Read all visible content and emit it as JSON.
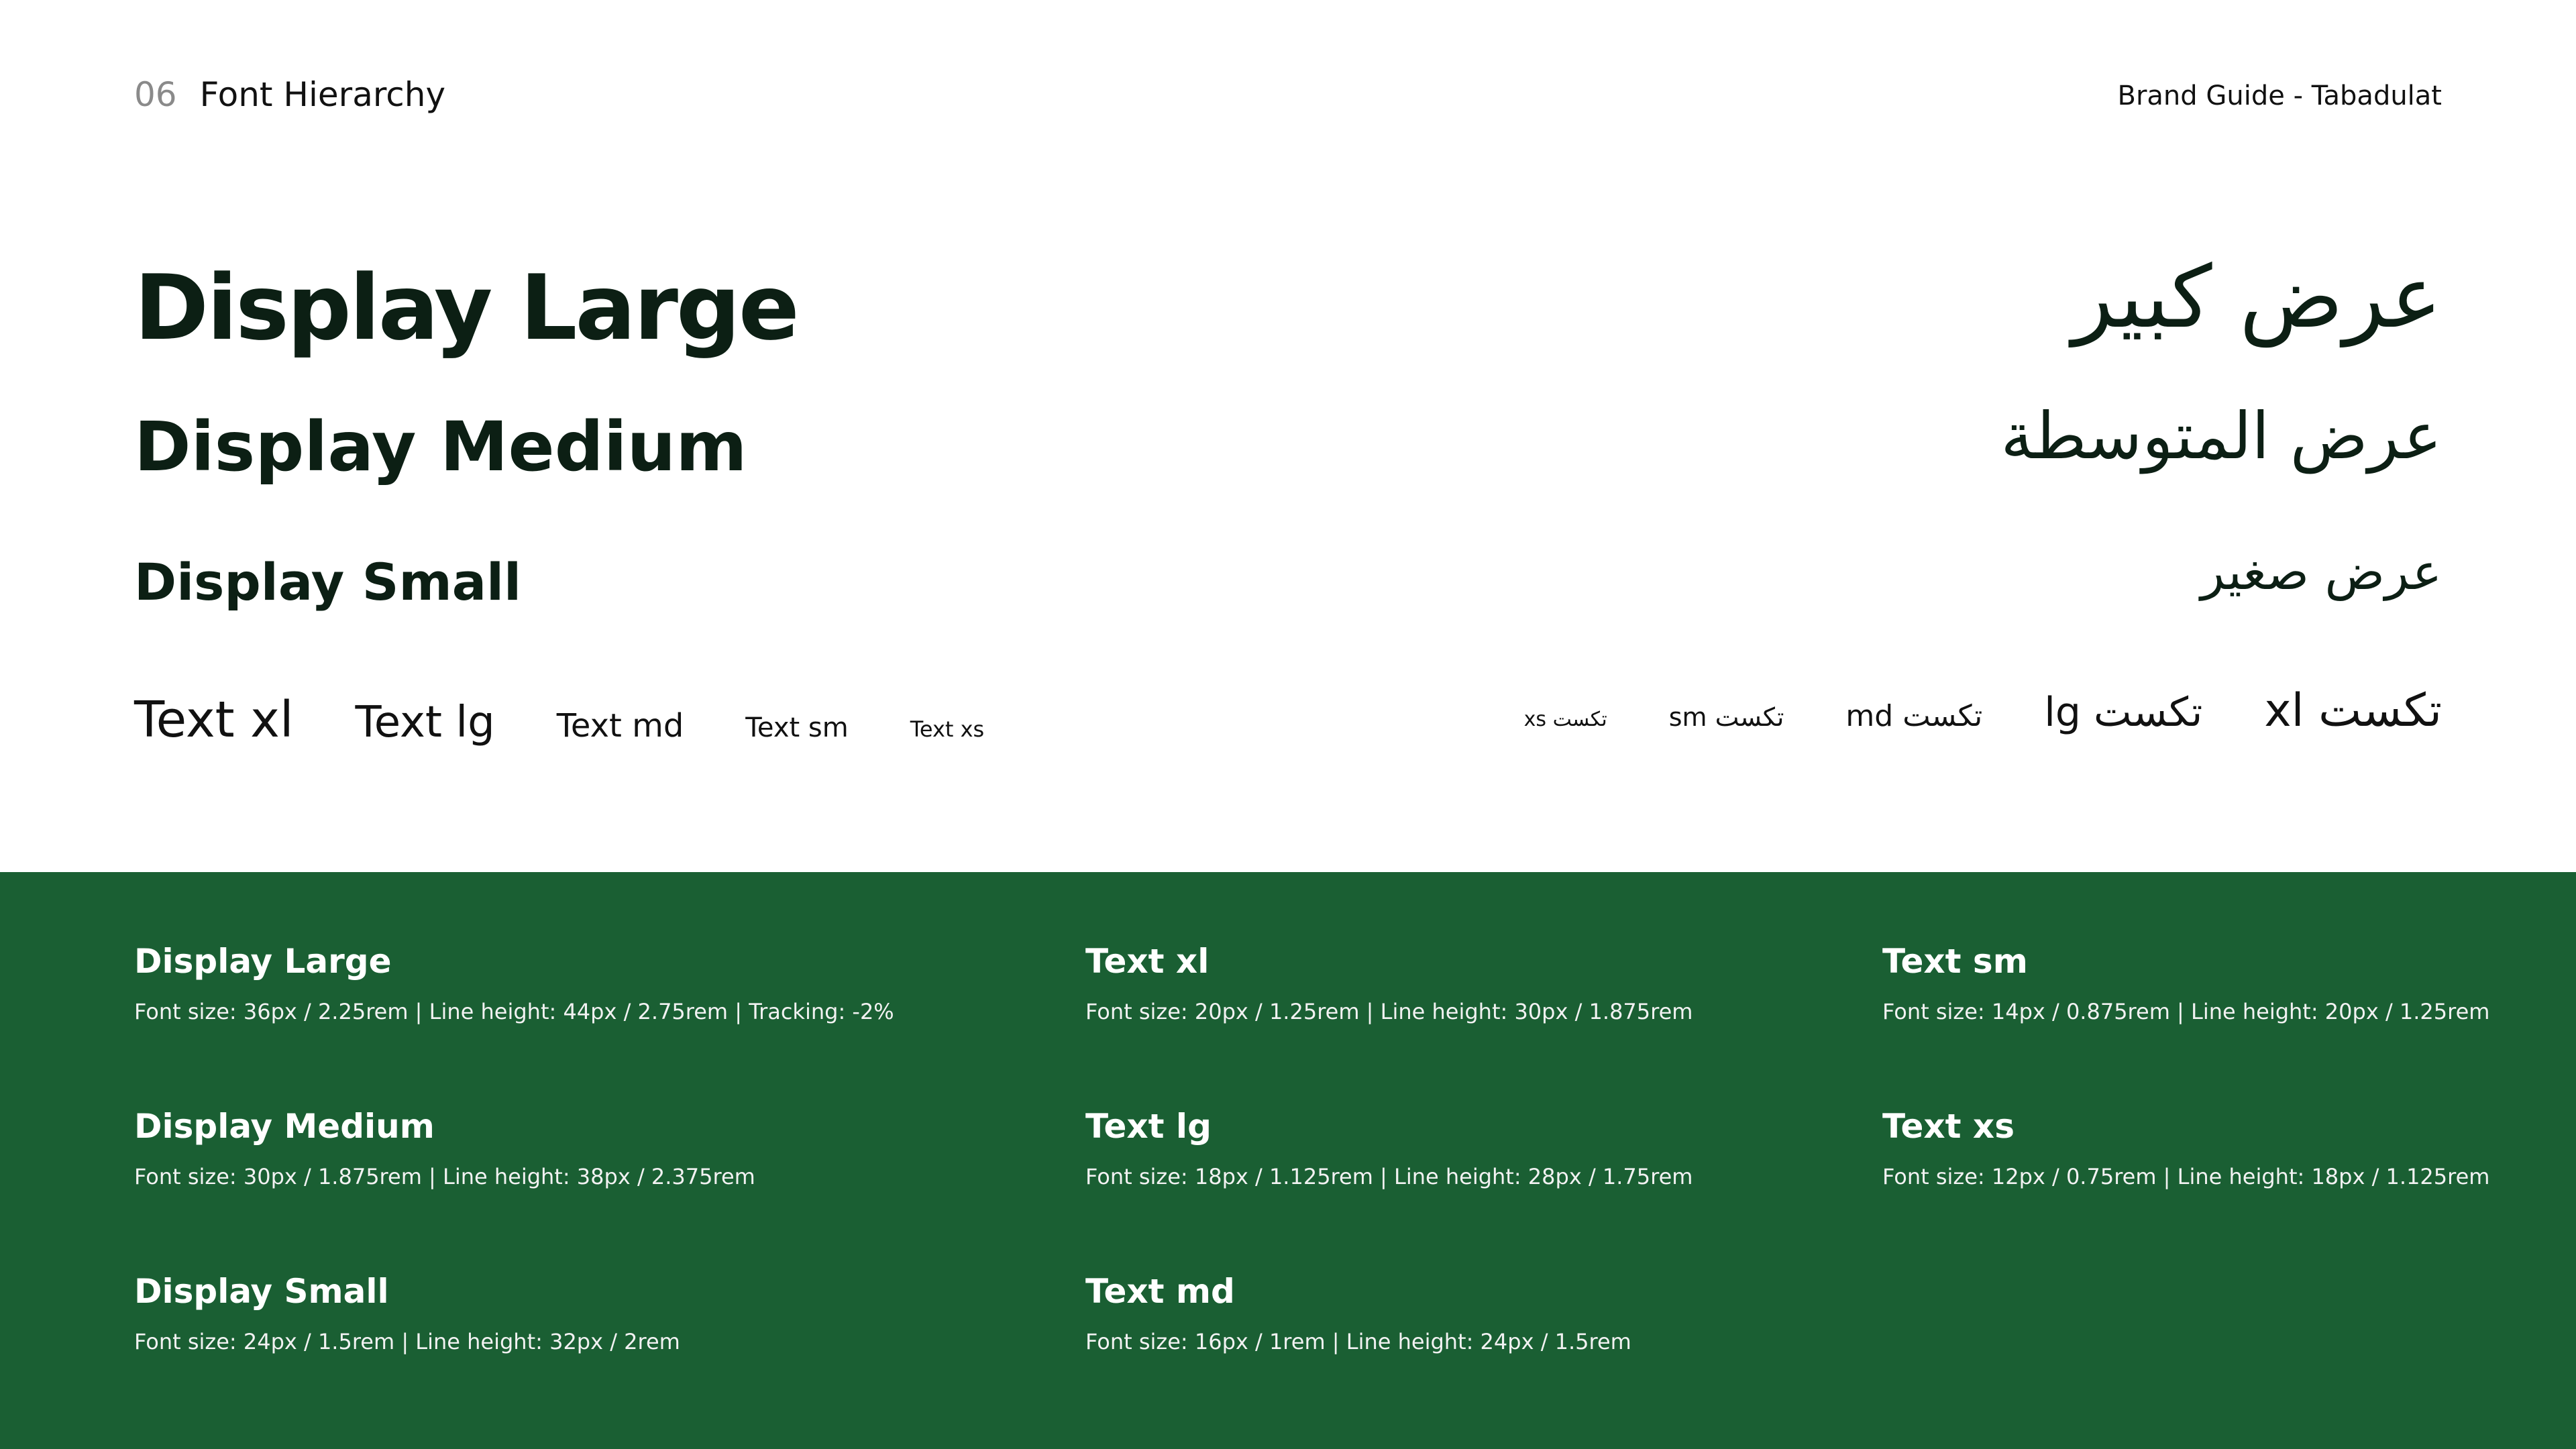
{
  "header": {
    "section_number": "06",
    "section_title": "Font Hierarchy",
    "brand_label": "Brand Guide - Tabadulat"
  },
  "display": {
    "large": "Display Large",
    "medium": "Display Medium",
    "small": "Display Small"
  },
  "arabic_display": {
    "large": "عرض كبير",
    "medium": "عرض المتوسطة",
    "small": "عرض صغير"
  },
  "text_samples": {
    "xl": "Text xl",
    "lg": "Text lg",
    "md": "Text md",
    "sm": "Text sm",
    "xs": "Text xs"
  },
  "arabic_text_samples": {
    "xl": "تكست xl",
    "lg": "تكست lg",
    "md": "تكست md",
    "sm": "تكست sm",
    "xs": "تكست xs"
  },
  "specs": [
    {
      "title": "Display Large",
      "desc": "Font size: 36px / 2.25rem | Line height: 44px / 2.75rem | Tracking: -2%"
    },
    {
      "title": "Display Medium",
      "desc": "Font size: 30px / 1.875rem | Line height: 38px / 2.375rem"
    },
    {
      "title": "Display Small",
      "desc": "Font size: 24px / 1.5rem | Line height: 32px / 2rem"
    },
    {
      "title": "Text xl",
      "desc": "Font size: 20px / 1.25rem | Line height: 30px / 1.875rem"
    },
    {
      "title": "Text lg",
      "desc": "Font size: 18px / 1.125rem | Line height: 28px / 1.75rem"
    },
    {
      "title": "Text md",
      "desc": "Font size: 16px / 1rem | Line height: 24px / 1.5rem"
    },
    {
      "title": "Text sm",
      "desc": "Font size: 14px / 0.875rem | Line height: 20px / 1.25rem"
    },
    {
      "title": "Text xs",
      "desc": "Font size: 12px / 0.75rem | Line height: 18px / 1.125rem"
    }
  ],
  "colors": {
    "primary_green": "#1a5f33",
    "text_dark": "#0c1f14",
    "muted_gray": "#8a8a8a",
    "background": "#ffffff"
  }
}
